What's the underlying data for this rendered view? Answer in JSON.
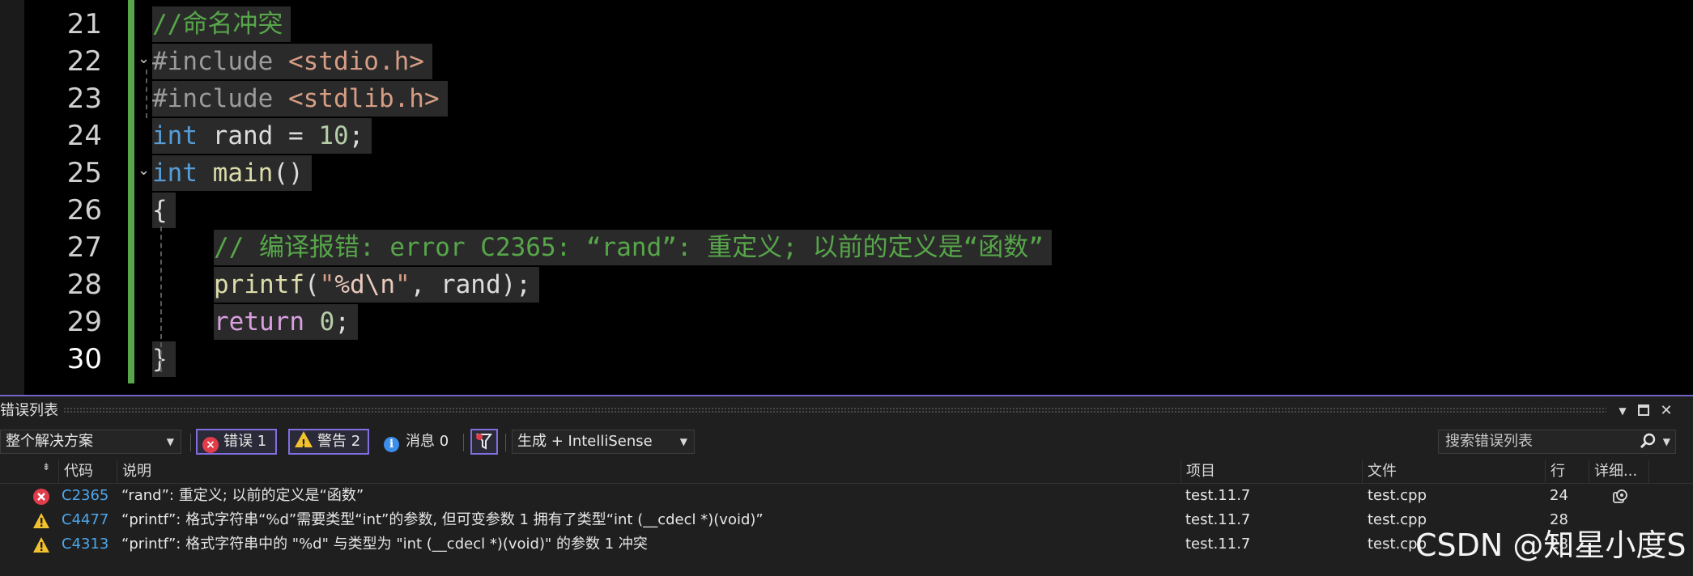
{
  "editor": {
    "lines": [
      {
        "number": "21",
        "tokens": [
          {
            "text": "//命名冲突",
            "type": "comment"
          }
        ]
      },
      {
        "number": "22",
        "tokens": [
          {
            "text": "#include ",
            "type": "pre"
          },
          {
            "text": "<stdio.h>",
            "type": "str"
          }
        ]
      },
      {
        "number": "23",
        "tokens": [
          {
            "text": "#include ",
            "type": "pre"
          },
          {
            "text": "<stdlib.h>",
            "type": "str"
          }
        ]
      },
      {
        "number": "24",
        "tokens": [
          {
            "text": "int",
            "type": "kw"
          },
          {
            "text": " rand = ",
            "type": "id"
          },
          {
            "text": "10",
            "type": "num"
          },
          {
            "text": ";",
            "type": "punc"
          }
        ]
      },
      {
        "number": "25",
        "tokens": [
          {
            "text": "int",
            "type": "kw"
          },
          {
            "text": " ",
            "type": "id"
          },
          {
            "text": "main",
            "type": "fn"
          },
          {
            "text": "()",
            "type": "punc"
          }
        ]
      },
      {
        "number": "26",
        "tokens": [
          {
            "text": "{",
            "type": "punc"
          }
        ]
      },
      {
        "number": "27",
        "tokens": [
          {
            "text": "// 编译报错: error C2365: “rand”: 重定义; 以前的定义是“函数”",
            "type": "comment"
          }
        ]
      },
      {
        "number": "28",
        "tokens": [
          {
            "text": "printf",
            "type": "fn"
          },
          {
            "text": "(",
            "type": "punc"
          },
          {
            "text": "\"",
            "type": "str"
          },
          {
            "text": "%d\\n",
            "type": "esc"
          },
          {
            "text": "\"",
            "type": "str"
          },
          {
            "text": ", rand);",
            "type": "id"
          }
        ]
      },
      {
        "number": "29",
        "tokens": [
          {
            "text": "return",
            "type": "ret"
          },
          {
            "text": " ",
            "type": "id"
          },
          {
            "text": "0",
            "type": "num"
          },
          {
            "text": ";",
            "type": "punc"
          }
        ]
      },
      {
        "number": "30",
        "tokens": [
          {
            "text": "}",
            "type": "punc"
          }
        ]
      }
    ]
  },
  "error_list": {
    "title": "错误列表",
    "scope": "整个解决方案",
    "errors_label": "错误 1",
    "warnings_label": "警告 2",
    "messages_label": "消息 0",
    "build_filter": "生成 + IntelliSense",
    "search_placeholder": "搜索错误列表",
    "columns": {
      "code": "代码",
      "description": "说明",
      "project": "项目",
      "file": "文件",
      "line": "行",
      "details": "详细..."
    },
    "rows": [
      {
        "severity": "error",
        "code": "C2365",
        "description": "“rand”: 重定义; 以前的定义是“函数”",
        "project": "test.11.7",
        "file": "test.cpp",
        "line": "24"
      },
      {
        "severity": "warning",
        "code": "C4477",
        "description": "“printf”: 格式字符串“%d”需要类型“int”的参数, 但可变参数 1 拥有了类型“int (__cdecl *)(void)”",
        "project": "test.11.7",
        "file": "test.cpp",
        "line": "28"
      },
      {
        "severity": "warning",
        "code": "C4313",
        "description": "“printf”: 格式字符串中的 \"%d\" 与类型为 \"int (__cdecl *)(void)\" 的参数 1 冲突",
        "project": "test.11.7",
        "file": "test.cpp",
        "line": "28"
      }
    ]
  },
  "watermark": "CSDN @知星小度S",
  "colors": {
    "accent": "#7f6fe0",
    "error": "#e03c4a",
    "warning": "#f2c12e",
    "info": "#3b8eea",
    "code_link": "#4ea6ea",
    "change_bar": "#57a64a"
  }
}
